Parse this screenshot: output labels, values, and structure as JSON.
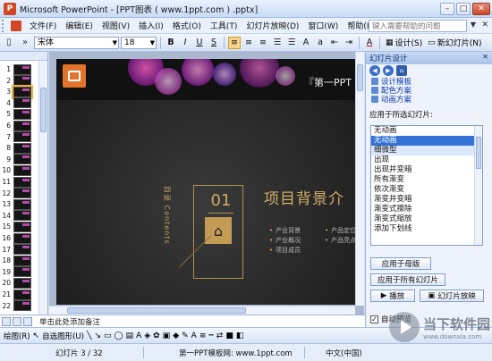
{
  "window": {
    "title": "Microsoft PowerPoint - [PPT图表 ( www.1ppt.com ) .pptx]",
    "minimize": "–",
    "maximize": "□",
    "close": "✕"
  },
  "menu": {
    "items": [
      "文件(F)",
      "编辑(E)",
      "视图(V)",
      "插入(I)",
      "格式(O)",
      "工具(T)",
      "幻灯片放映(D)",
      "窗口(W)",
      "帮助(H)"
    ],
    "help_placeholder": "键入需要帮助的问题",
    "close": "✕"
  },
  "toolbar": {
    "font_name": "宋体",
    "font_size": "18",
    "bold": "B",
    "italic": "I",
    "underline": "U",
    "shadow": "S",
    "font_color_label": "A",
    "design_label": "设计(S)",
    "new_slide_label": "新幻灯片(N)"
  },
  "slides_pane": {
    "numbers": [
      "1",
      "2",
      "3",
      "4",
      "5",
      "6",
      "7",
      "8",
      "9",
      "10",
      "11",
      "12",
      "13",
      "14",
      "15",
      "16",
      "17",
      "18",
      "19",
      "20",
      "21",
      "22"
    ],
    "selected": "3"
  },
  "slide": {
    "banner_text": "『第一PPT",
    "toc_vertical": "目录 Contents",
    "toc_number": "01",
    "heading": "项目背景介",
    "bullets": [
      "产业背景",
      "产业概况",
      "项目成员",
      "产品定位",
      "产品亮点"
    ]
  },
  "task_pane": {
    "title": "幻灯片设计",
    "close": "✕",
    "links": [
      "设计模板",
      "配色方案",
      "动画方案"
    ],
    "apply_label": "应用于所选幻灯片:",
    "animations": [
      "无动画",
      "无动画",
      "细微型",
      "出现",
      "出现并变暗",
      "所有渐变",
      "依次渐变",
      "渐变并变暗",
      "渐变式擦除",
      "渐变式缩放",
      "添加下划线"
    ],
    "apply_master_button": "应用于母版",
    "apply_all_button": "应用于所有幻灯片",
    "play_button": "播放",
    "slideshow_button": "幻灯片放映",
    "autopreview_label": "自动预览",
    "autopreview_checked": true
  },
  "notes": {
    "placeholder": "单击此处添加备注"
  },
  "drawing_toolbar": {
    "draw_label": "绘图(R)",
    "autoshapes_label": "自选图形(U)"
  },
  "status": {
    "slide_info": "幻灯片 3 / 32",
    "template": "第一PPT模板网: www.1ppt.com",
    "language": "中文(中国)"
  },
  "watermark": {
    "main": "当下软件园",
    "sub": "www.downxia.com"
  },
  "colors": {
    "accent_gold": "#c9a35a",
    "selection_blue": "#3574d6",
    "logo_orange": "#e2742a"
  }
}
